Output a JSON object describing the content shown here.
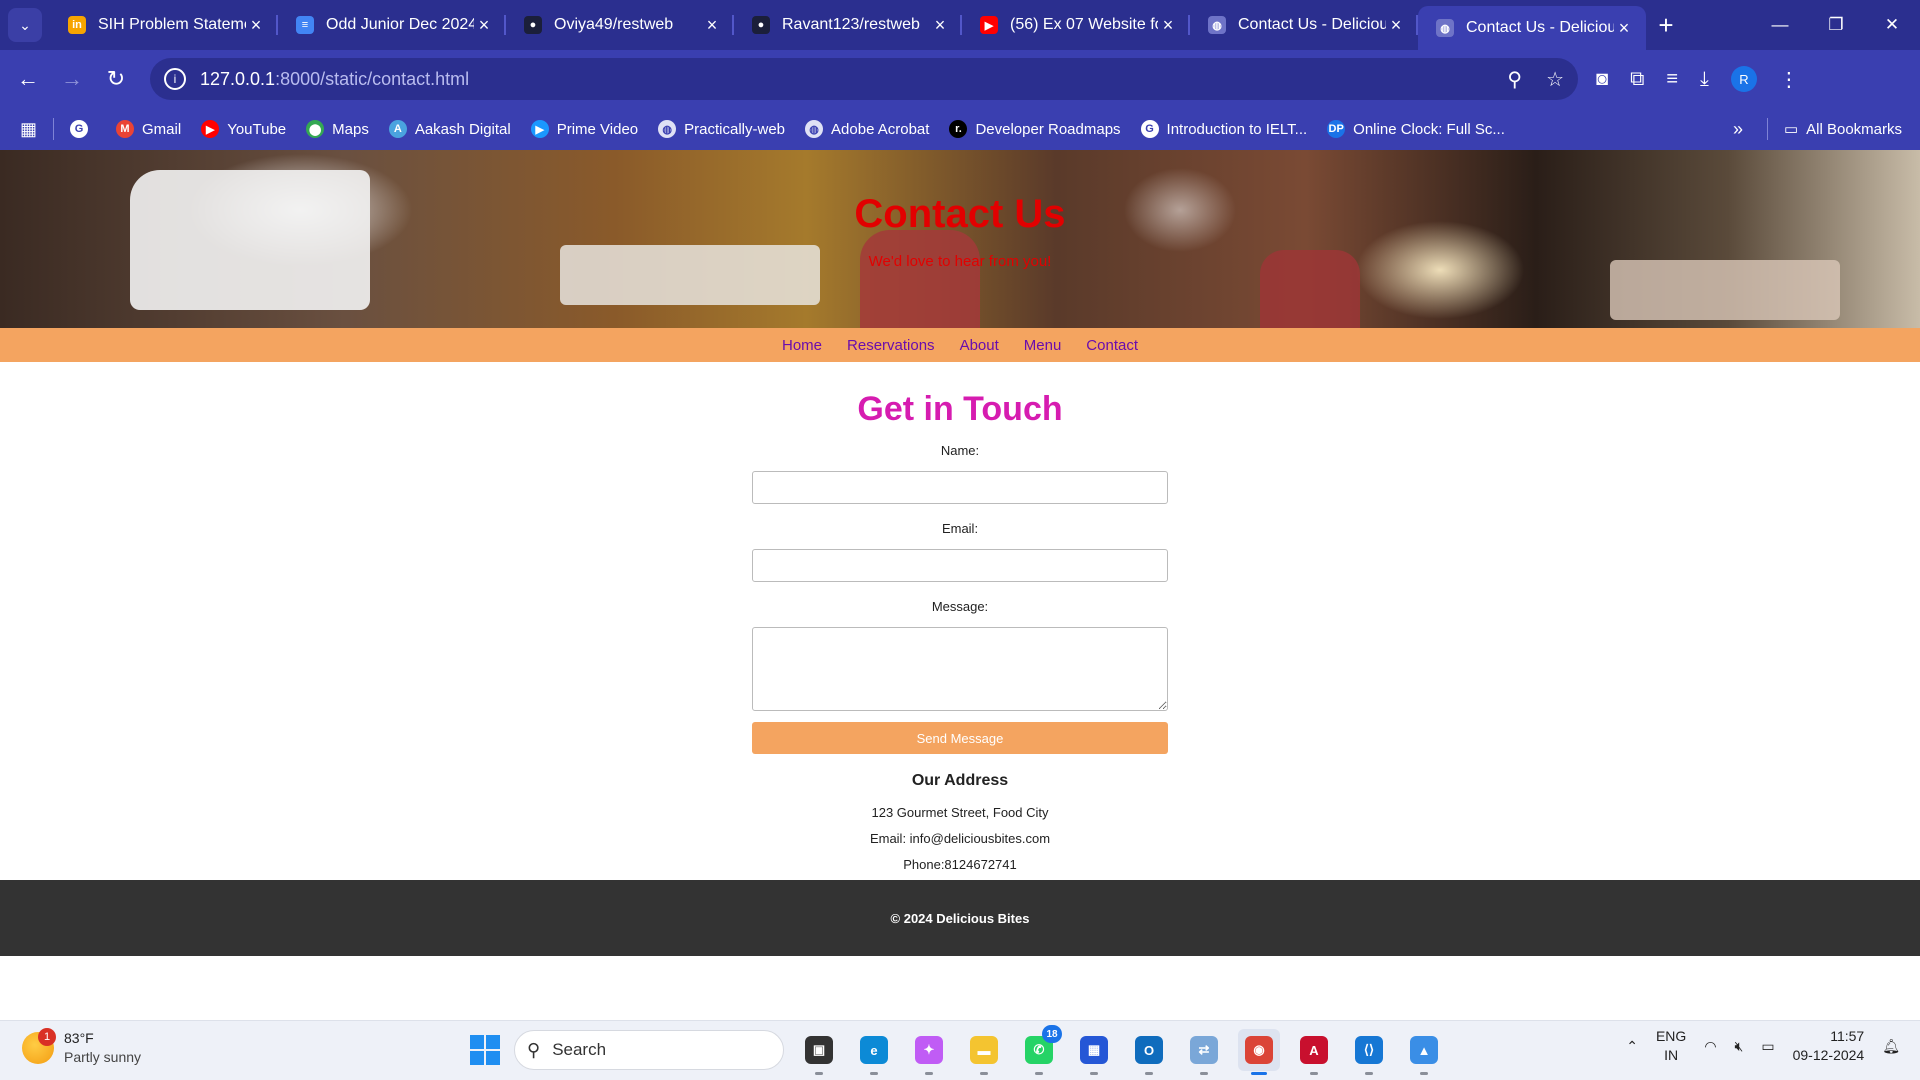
{
  "browser": {
    "tabs": [
      {
        "title": "SIH Problem Stateme",
        "icon": "unstop-icon",
        "color": "#f7a400",
        "glyph": "in"
      },
      {
        "title": "Odd Junior Dec 2024",
        "icon": "docs-icon",
        "color": "#4285f4",
        "glyph": "≡"
      },
      {
        "title": "Oviya49/restweb",
        "icon": "github-icon",
        "color": "#1b1f3a",
        "glyph": "●"
      },
      {
        "title": "Ravant123/restweb",
        "icon": "github-icon",
        "color": "#1b1f3a",
        "glyph": "●"
      },
      {
        "title": "(56) Ex 07 Website fo",
        "icon": "youtube-icon",
        "color": "#ff0000",
        "glyph": "▶"
      },
      {
        "title": "Contact Us - Deliciou",
        "icon": "globe-icon",
        "color": "#6e73c7",
        "glyph": "◍"
      },
      {
        "title": "Contact Us - Deliciou",
        "icon": "globe-icon",
        "color": "#6e73c7",
        "glyph": "◍"
      }
    ],
    "active_tab_index": 6,
    "url_host": "127.0.0.1",
    "url_path": ":8000/static/contact.html",
    "profile_initial": "R",
    "bookmarks": [
      {
        "label": "",
        "icon": "google-icon",
        "color": "#ffffff",
        "glyph": "G"
      },
      {
        "label": "Gmail",
        "icon": "gmail-icon",
        "color": "#ea4335",
        "glyph": "M"
      },
      {
        "label": "YouTube",
        "icon": "youtube-icon",
        "color": "#ff0000",
        "glyph": "▶"
      },
      {
        "label": "Maps",
        "icon": "maps-icon",
        "color": "#34a853",
        "glyph": "⬤"
      },
      {
        "label": "Aakash Digital",
        "icon": "aakash-icon",
        "color": "#4aa3df",
        "glyph": "A"
      },
      {
        "label": "Prime Video",
        "icon": "prime-video-icon",
        "color": "#1a98ff",
        "glyph": "▶"
      },
      {
        "label": "Practically-web",
        "icon": "globe-icon",
        "color": "#dfe1f5",
        "glyph": "◍"
      },
      {
        "label": "Adobe Acrobat",
        "icon": "globe-icon",
        "color": "#dfe1f5",
        "glyph": "◍"
      },
      {
        "label": "Developer Roadmaps",
        "icon": "roadmap-icon",
        "color": "#000000",
        "glyph": "r."
      },
      {
        "label": "Introduction to IELT...",
        "icon": "google-icon",
        "color": "#ffffff",
        "glyph": "G"
      },
      {
        "label": "Online Clock: Full Sc...",
        "icon": "dp-icon",
        "color": "#1a73e8",
        "glyph": "DP"
      }
    ],
    "all_bookmarks_label": "All Bookmarks"
  },
  "site": {
    "hero_title": "Contact Us",
    "hero_subtitle": "We'd love to hear from you!",
    "nav": [
      "Home",
      "Reservations",
      "About",
      "Menu",
      "Contact"
    ],
    "heading": "Get in Touch",
    "form": {
      "name_label": "Name:",
      "name_value": "",
      "email_label": "Email:",
      "email_value": "",
      "message_label": "Message:",
      "message_value": "",
      "submit_label": "Send Message"
    },
    "address": {
      "heading": "Our Address",
      "street": "123 Gourmet Street, Food City",
      "email": "Email: info@deliciousbites.com",
      "phone": "Phone:8124672741"
    },
    "footer": "© 2024 Delicious Bites",
    "colors": {
      "hero_text": "#e20000",
      "nav_bar": "#f4a460",
      "nav_link": "#6a0dad",
      "heading": "#d61cb0",
      "button": "#f4a460",
      "footer_bg": "#333333"
    }
  },
  "taskbar": {
    "weather_temp": "83°F",
    "weather_cond": "Partly sunny",
    "weather_badge": "1",
    "search_label": "Search",
    "apps": [
      {
        "name": "task-view-icon",
        "color": "#333333",
        "glyph": "▣",
        "badge": "",
        "active": false
      },
      {
        "name": "edge-icon",
        "color": "#0c8ad6",
        "glyph": "e",
        "badge": "",
        "active": false
      },
      {
        "name": "copilot-icon",
        "color": "#c05cf5",
        "glyph": "✦",
        "badge": "",
        "active": false
      },
      {
        "name": "file-explorer-icon",
        "color": "#f4c430",
        "glyph": "▬",
        "badge": "",
        "active": false
      },
      {
        "name": "whatsapp-icon",
        "color": "#25d366",
        "glyph": "✆",
        "badge": "18",
        "active": false
      },
      {
        "name": "store-icon",
        "color": "#2557d6",
        "glyph": "▦",
        "badge": "",
        "active": false
      },
      {
        "name": "outlook-icon",
        "color": "#0f6cbd",
        "glyph": "O",
        "badge": "",
        "active": false
      },
      {
        "name": "network-app-icon",
        "color": "#7aa7d8",
        "glyph": "⇄",
        "badge": "",
        "active": false
      },
      {
        "name": "chrome-icon",
        "color": "#db4437",
        "glyph": "◉",
        "badge": "",
        "active": true
      },
      {
        "name": "acrobat-icon",
        "color": "#c8102e",
        "glyph": "A",
        "badge": "",
        "active": false
      },
      {
        "name": "vscode-icon",
        "color": "#1677d4",
        "glyph": "⟨⟩",
        "badge": "",
        "active": false
      },
      {
        "name": "photos-icon",
        "color": "#3a8ee6",
        "glyph": "▲",
        "badge": "",
        "active": false
      }
    ],
    "lang_line1": "ENG",
    "lang_line2": "IN",
    "time": "11:57",
    "date": "09-12-2024"
  }
}
